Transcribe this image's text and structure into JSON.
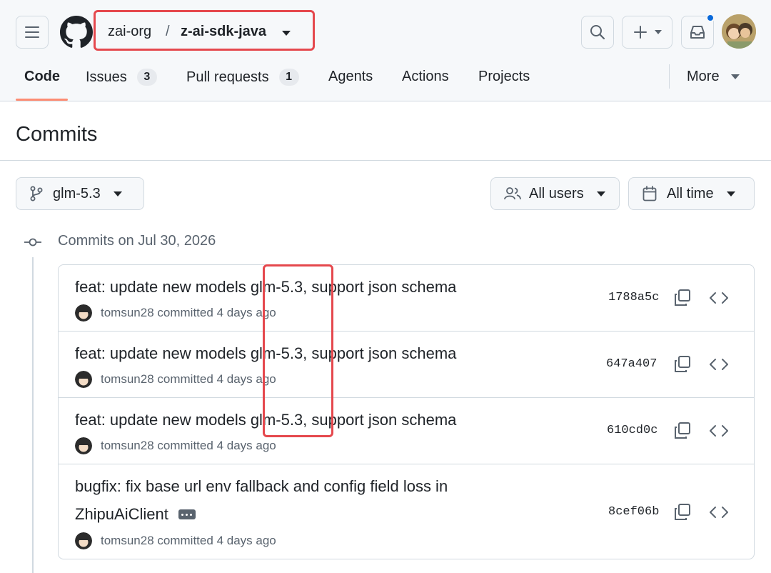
{
  "repo": {
    "owner": "zai-org",
    "separator": "/",
    "name": "z-ai-sdk-java"
  },
  "nav": {
    "code": "Code",
    "issues": "Issues",
    "issues_count": "3",
    "pull_requests": "Pull requests",
    "pull_requests_count": "1",
    "agents": "Agents",
    "actions": "Actions",
    "projects": "Projects",
    "more": "More"
  },
  "page": {
    "title": "Commits"
  },
  "filters": {
    "branch": "glm-5.3",
    "users": "All users",
    "time": "All time"
  },
  "timeline": {
    "group_label": "Commits on Jul 30, 2026"
  },
  "commits": [
    {
      "message": "feat: update new models glm-5.3, support json schema",
      "author": "tomsun28",
      "action": "committed",
      "time": "4 days ago",
      "sha": "1788a5c"
    },
    {
      "message": "feat: update new models glm-5.3, support json schema",
      "author": "tomsun28",
      "action": "committed",
      "time": "4 days ago",
      "sha": "647a407"
    },
    {
      "message": "feat: update new models glm-5.3, support json schema",
      "author": "tomsun28",
      "action": "committed",
      "time": "4 days ago",
      "sha": "610cd0c"
    },
    {
      "message_line1": "bugfix: fix base url env fallback and config field loss in",
      "message_line2": "ZhipuAiClient",
      "author": "tomsun28",
      "action": "committed",
      "time": "4 days ago",
      "sha": "8cef06b"
    }
  ],
  "icons": [
    "hamburger-icon",
    "github-logo-icon",
    "search-icon",
    "plus-icon",
    "inbox-icon",
    "branch-icon",
    "people-icon",
    "calendar-icon",
    "commit-icon",
    "copy-icon",
    "code-icon",
    "ellipsis-icon"
  ],
  "colors": {
    "highlight": "#e5484d",
    "tab_underline": "#fd8c73",
    "notification": "#0969da"
  }
}
